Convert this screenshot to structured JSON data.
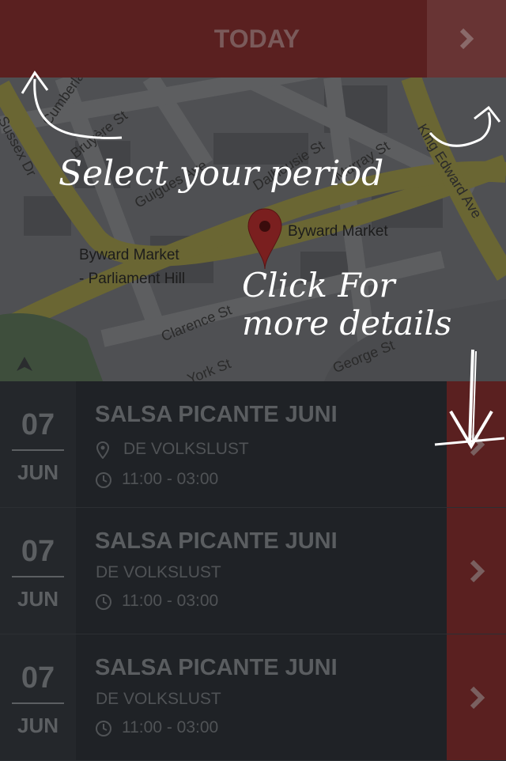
{
  "header": {
    "title": "TODAY",
    "next_icon": "chevron-right-icon"
  },
  "map": {
    "streets": [
      "Sussex Dr",
      "Cumberland St",
      "Bruyère St",
      "Guigues Ave",
      "Dalhousie St",
      "Murray St",
      "Clarence St",
      "York St",
      "George St",
      "King Edward Ave"
    ],
    "places": [
      "Byward Market",
      "Byward Market\n- Parliament Hill"
    ],
    "pin_icon": "map-pin-icon",
    "compass_icon": "north-arrow-icon"
  },
  "annotations": {
    "select_period": "Select your period",
    "click_details_1": "Click For",
    "click_details_2": "more details"
  },
  "events": [
    {
      "day": "07",
      "month": "JUN",
      "title": "SALSA PICANTE JUNI",
      "venue": "DE VOLKSLUST",
      "time": "11:00 - 03:00"
    },
    {
      "day": "07",
      "month": "JUN",
      "title": "SALSA PICANTE JUNI",
      "venue": "DE VOLKSLUST",
      "time": "11:00 - 03:00"
    },
    {
      "day": "07",
      "month": "JUN",
      "title": "SALSA PICANTE JUNI",
      "venue": "DE VOLKSLUST",
      "time": "11:00 - 03:00"
    }
  ],
  "colors": {
    "accent": "#5a2020",
    "list_bg": "#1f2226",
    "text_muted": "#5c5f62"
  }
}
